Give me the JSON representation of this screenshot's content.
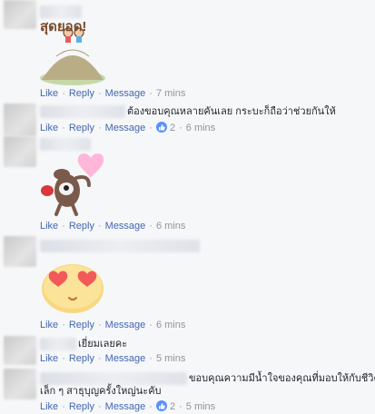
{
  "actions": {
    "like": "Like",
    "reply": "Reply",
    "message": "Message",
    "sep": "·"
  },
  "comments": [
    {
      "time": "7 mins"
    },
    {
      "text": "ต้องขอบคุณหลายคันเลย กระบะก็ถือว่าช่วยกันให้",
      "likes": "2",
      "time": "6 mins"
    },
    {
      "time": "6 mins"
    },
    {
      "time": "6 mins"
    },
    {
      "text": "เยี่ยมเลยคะ",
      "time": "5 mins"
    },
    {
      "text_line1": "ขอบคุณความมีน้ำใจของคุณที่มอบให้กับชีวิต",
      "text_line2": "เล็ก ๆ สาธุบุญครั้งใหญ่นะคับ",
      "likes": "2",
      "time": "5 mins"
    }
  ],
  "sticker1": {
    "caption": "สุดยอด!"
  },
  "colors": {
    "link": "#4267b2",
    "meta": "#90949c",
    "background": "#f6f7f9",
    "like_badge": "#5890ff"
  }
}
